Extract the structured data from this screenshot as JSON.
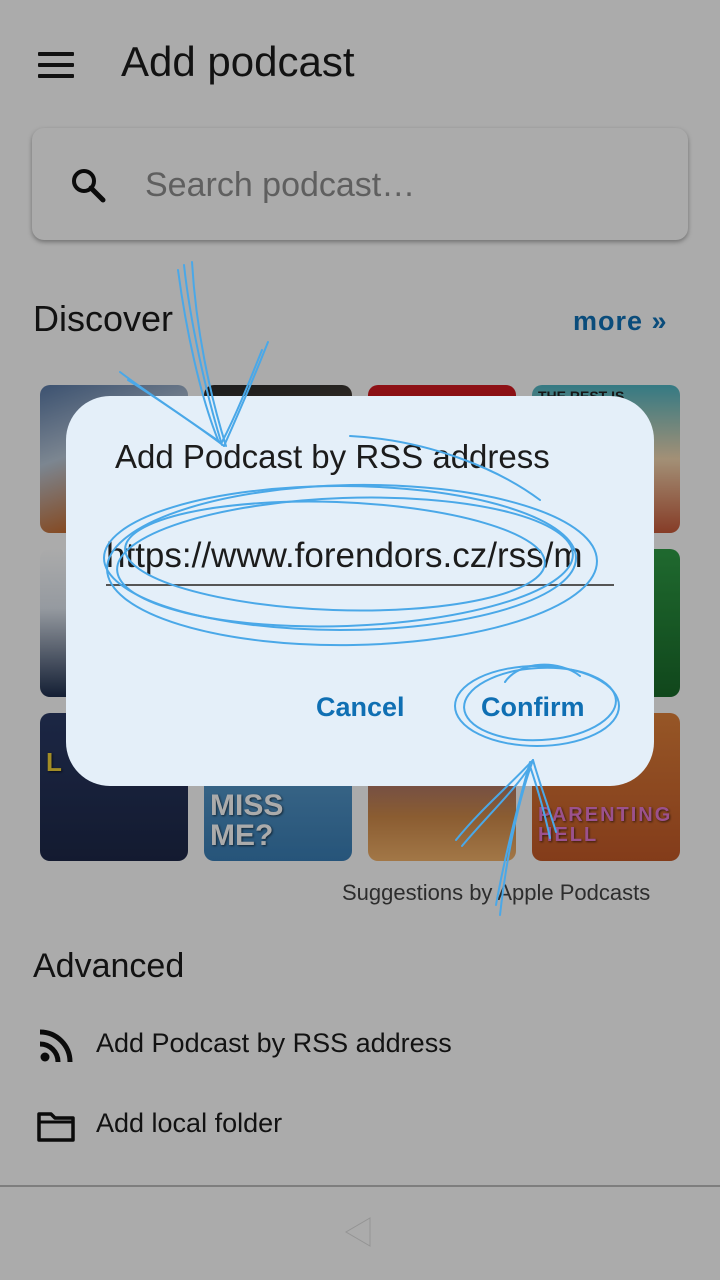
{
  "header": {
    "title": "Add podcast",
    "menu_icon": "menu-icon"
  },
  "search": {
    "placeholder": "Search podcast…",
    "icon": "search-icon"
  },
  "discover": {
    "title": "Discover",
    "more_label": "more »",
    "tiles": [
      {
        "text": ""
      },
      {
        "text": ""
      },
      {
        "text": ""
      },
      {
        "text": "THE REST IS"
      },
      {
        "text": ""
      },
      {
        "text": ""
      },
      {
        "text": "L"
      },
      {
        "text": "MISS ME?"
      },
      {
        "text": ""
      },
      {
        "text": "PARENTING HELL"
      }
    ],
    "suggestions": "Suggestions by Apple Podcasts"
  },
  "advanced": {
    "title": "Advanced",
    "items": [
      {
        "label": "Add Podcast by RSS address",
        "icon": "rss-icon"
      },
      {
        "label": "Add local folder",
        "icon": "folder-icon"
      }
    ]
  },
  "nav": {
    "back_icon": "back-triangle-icon"
  },
  "dialog": {
    "title": "Add Podcast by RSS address",
    "url_value": "https://www.forendors.cz/rss/m",
    "cancel_label": "Cancel",
    "confirm_label": "Confirm"
  },
  "colors": {
    "accent": "#0f6fb3",
    "dialog_bg": "#e4eff9",
    "annotation": "#4aa8e8"
  }
}
